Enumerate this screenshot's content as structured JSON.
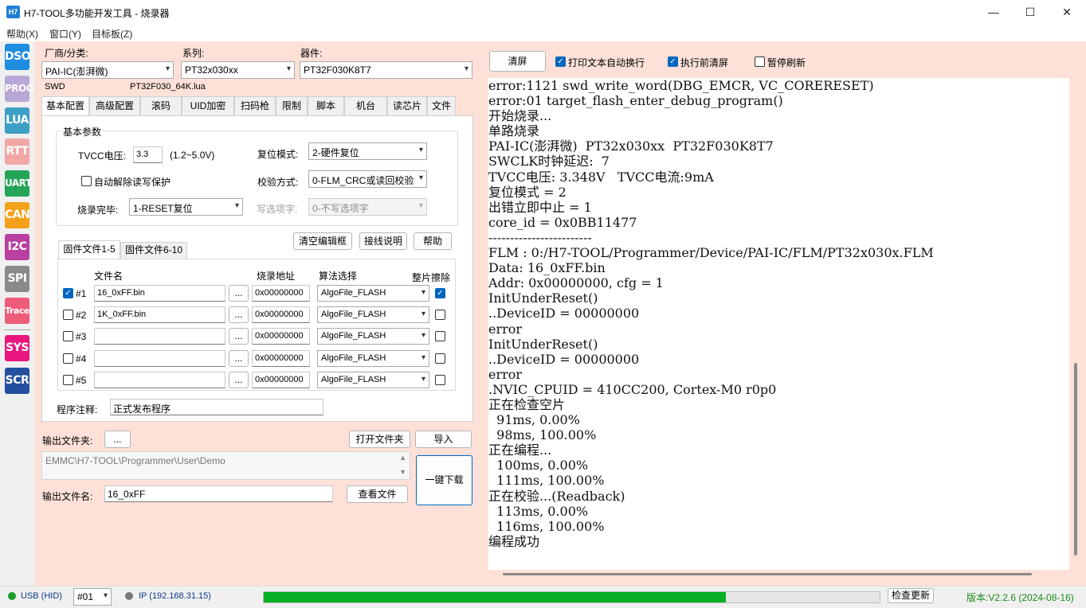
{
  "window": {
    "icon_text": "H7",
    "title": "H7-TOOL多功能开发工具 - 烧录器",
    "minimize": "—",
    "maximize": "☐",
    "close": "✕"
  },
  "menu": [
    "帮助(X)",
    "窗口(Y)",
    "目标板(Z)"
  ],
  "sidebar": [
    {
      "label": "DSO",
      "color": "#1e8ce0"
    },
    {
      "label": "PROG",
      "color": "#b9a8d6"
    },
    {
      "label": "LUA",
      "color": "#3d9fc6"
    },
    {
      "label": "RTT",
      "color": "#f2a7a7"
    },
    {
      "label": "UART",
      "color": "#23a456"
    },
    {
      "label": "CAN",
      "color": "#f3a01a"
    },
    {
      "label": "I2C",
      "color": "#b93fa0"
    },
    {
      "label": "SPI",
      "color": "#8a8a8a"
    },
    {
      "label": "Trace",
      "color": "#ef5b7a"
    },
    {
      "label": "SYS",
      "color": "#e8167e"
    },
    {
      "label": "SCR",
      "color": "#234f9e"
    }
  ],
  "selectors": {
    "vendor_label": "厂商/分类:",
    "vendor_value": "PAI-IC(澎湃微)",
    "series_label": "系列:",
    "series_value": "PT32x030xx",
    "device_label": "器件:",
    "device_value": "PT32F030K8T7",
    "interface": "SWD",
    "lua_file": "PT32F030_64K.lua"
  },
  "tabs": [
    "基本配置",
    "高级配置",
    "滚码",
    "UID加密",
    "扫码枪",
    "限制",
    "脚本",
    "机台",
    "读芯片",
    "文件"
  ],
  "basic": {
    "group_title": "基本参数",
    "tvcc_label": "TVCC电压:",
    "tvcc_value": "3.3",
    "tvcc_range": "(1.2~5.0V)",
    "reset_label": "复位模式:",
    "reset_value": "2-硬件复位",
    "auto_unprotect": "自动解除读写保护",
    "verify_label": "校验方式:",
    "verify_value": "0-FLM_CRC或读回校验",
    "finish_label": "烧录完毕:",
    "finish_value": "1-RESET复位",
    "option_label": "写选项字:",
    "option_value": "0-不写选项字"
  },
  "firmware": {
    "clear_btn": "清空编辑框",
    "wiring_btn": "接线说明",
    "help_btn": "帮助",
    "subtabs": [
      "固件文件1-5",
      "固件文件6-10"
    ],
    "col_file": "文件名",
    "col_addr": "烧录地址",
    "col_algo": "算法选择",
    "col_erase": "整片擦除",
    "browse": "...",
    "rows": [
      {
        "id": "#1",
        "checked": true,
        "file": "16_0xFF.bin",
        "addr": "0x00000000",
        "algo": "AlgoFile_FLASH",
        "erase": true
      },
      {
        "id": "#2",
        "checked": false,
        "file": "1K_0xFF.bin",
        "addr": "0x00000000",
        "algo": "AlgoFile_FLASH",
        "erase": false
      },
      {
        "id": "#3",
        "checked": false,
        "file": "",
        "addr": "0x00000000",
        "algo": "AlgoFile_FLASH",
        "erase": false
      },
      {
        "id": "#4",
        "checked": false,
        "file": "",
        "addr": "0x00000000",
        "algo": "AlgoFile_FLASH",
        "erase": false
      },
      {
        "id": "#5",
        "checked": false,
        "file": "",
        "addr": "0x00000000",
        "algo": "AlgoFile_FLASH",
        "erase": false
      }
    ],
    "note_label": "程序注释:",
    "note_value": "正式发布程序"
  },
  "output": {
    "folder_label": "输出文件夹:",
    "folder_btn": "...",
    "open_folder_btn": "打开文件夹",
    "import_btn": "导入",
    "path": "EMMC\\H7-TOOL\\Programmer\\User\\Demo",
    "name_label": "输出文件名:",
    "name_value": "16_0xFF",
    "view_btn": "查看文件",
    "download_btn": "一键下载"
  },
  "log_toolbar": {
    "clear_btn": "清屏",
    "wrap_label": "打印文本自动换行",
    "wrap_checked": true,
    "clear_before_label": "执行前清屏",
    "clear_before_checked": true,
    "pause_label": "暂停刷新",
    "pause_checked": false
  },
  "log_lines": [
    "error:1121 swd_write_word(DBG_EMCR, VC_CORERESET)",
    "error:01 target_flash_enter_debug_program()",
    "开始烧录...",
    "单路烧录",
    "PAI-IC(澎湃微)  PT32x030xx  PT32F030K8T7",
    "SWCLK时钟延迟:  7",
    "TVCC电压: 3.348V   TVCC电流:9mA",
    "复位模式 = 2",
    "出错立即中止 = 1",
    "core_id = 0x0BB11477",
    "------------------------",
    "FLM : 0:/H7-TOOL/Programmer/Device/PAI-IC/FLM/PT32x030x.FLM",
    "Data: 16_0xFF.bin",
    "Addr: 0x00000000, cfg = 1",
    "InitUnderReset()",
    "..DeviceID = 00000000",
    "error",
    "InitUnderReset()",
    "..DeviceID = 00000000",
    "error",
    ".NVIC_CPUID = 410CC200, Cortex-M0 r0p0",
    "正在检查空片",
    "  91ms, 0.00%",
    "  98ms, 100.00%",
    "正在编程...",
    "  100ms, 0.00%",
    "  111ms, 100.00%",
    "正在校验...(Readback)",
    "  113ms, 0.00%",
    "  116ms, 100.00%",
    "编程成功"
  ],
  "status": {
    "usb": "USB (HID)",
    "usb_color": "#1a9e2a",
    "device_no": "#01",
    "ip": "IP (192.168.31.15)",
    "ip_color": "#777777",
    "progress": 0.75,
    "update_btn": "检查更新",
    "version": "版本:V2.2.6 (2024-08-16)",
    "version_color": "#1a8a1a"
  }
}
